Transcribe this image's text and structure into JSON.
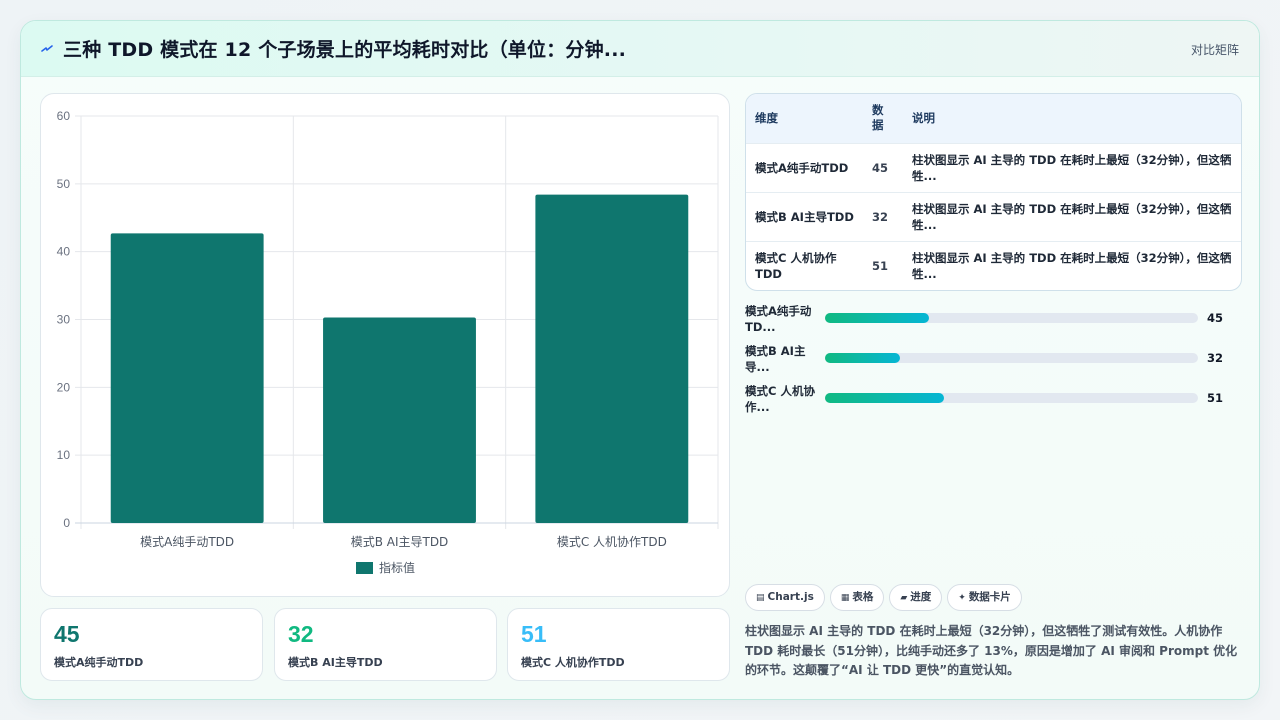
{
  "header": {
    "title": "三种 TDD 模式在 12 个子场景上的平均耗时对比（单位：分钟...",
    "tag": "对比矩阵",
    "icon": "bolt-icon"
  },
  "chart_data": {
    "type": "bar",
    "categories": [
      "模式A纯手动TDD",
      "模式B AI主导TDD",
      "模式C 人机协作TDD"
    ],
    "series": [
      {
        "name": "指标值",
        "values": [
          42.7,
          30.3,
          48.4
        ],
        "color": "#0f766e"
      }
    ],
    "ylim": [
      0,
      60
    ],
    "yticks": [
      0,
      10,
      20,
      30,
      40,
      50,
      60
    ],
    "grid": true,
    "legend_position": "bottom"
  },
  "stats": [
    {
      "value": "45",
      "label": "模式A纯手动TDD",
      "color": "#0f766e"
    },
    {
      "value": "32",
      "label": "模式B AI主导TDD",
      "color": "#10b981"
    },
    {
      "value": "51",
      "label": "模式C 人机协作TDD",
      "color": "#38bdf8"
    }
  ],
  "table": {
    "headers": [
      "维度",
      "数据",
      "说明"
    ],
    "rows": [
      {
        "dim": "模式A纯手动TDD",
        "val": "45",
        "desc": "柱状图显示 AI 主导的 TDD 在耗时上最短（32分钟），但这牺牲..."
      },
      {
        "dim": "模式B AI主导TDD",
        "val": "32",
        "desc": "柱状图显示 AI 主导的 TDD 在耗时上最短（32分钟），但这牺牲..."
      },
      {
        "dim": "模式C 人机协作TDD",
        "val": "51",
        "desc": "柱状图显示 AI 主导的 TDD 在耗时上最短（32分钟），但这牺牲..."
      }
    ]
  },
  "progress": [
    {
      "label": "模式A纯手动TD...",
      "value": "45",
      "fraction": 0.28
    },
    {
      "label": "模式B AI主导...",
      "value": "32",
      "fraction": 0.2
    },
    {
      "label": "模式C 人机协作...",
      "value": "51",
      "fraction": 0.32
    }
  ],
  "chips": [
    {
      "icon": "▤",
      "label": "Chart.js"
    },
    {
      "icon": "▦",
      "label": "表格"
    },
    {
      "icon": "▰",
      "label": "进度"
    },
    {
      "icon": "✦",
      "label": "数据卡片"
    }
  ],
  "summary": "柱状图显示 AI 主导的 TDD 在耗时上最短（32分钟），但这牺牲了测试有效性。人机协作 TDD 耗时最长（51分钟），比纯手动还多了 13%，原因是增加了 AI 审阅和 Prompt 优化的环节。这颠覆了“AI 让 TDD 更快”的直觉认知。"
}
